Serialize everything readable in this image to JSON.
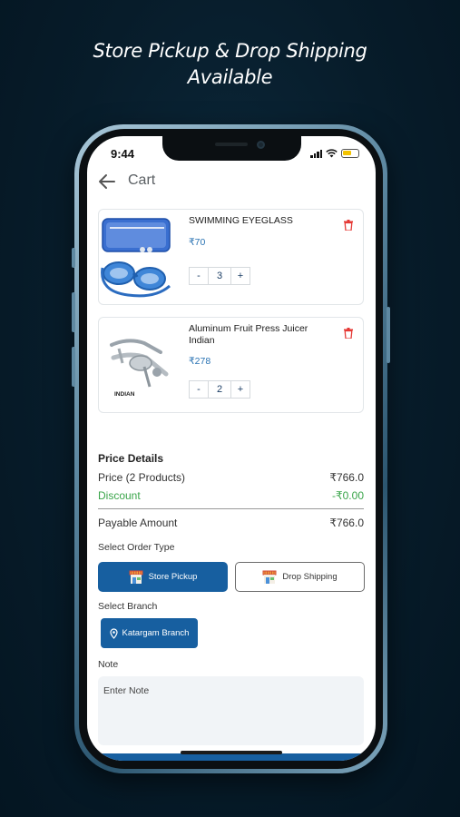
{
  "promo": {
    "line1": "Store Pickup & Drop Shipping",
    "line2": "Available"
  },
  "status_bar": {
    "time": "9:44",
    "icons": [
      "signal-icon",
      "wifi-icon",
      "battery-icon"
    ],
    "battery_color": "#f3c300"
  },
  "header": {
    "title": "Cart",
    "back_icon": "arrow-left-icon"
  },
  "cart_items": [
    {
      "name": "SWIMMING EYEGLASS",
      "price": "₹70",
      "quantity": "3",
      "decrement": "-",
      "increment": "+"
    },
    {
      "name": "Aluminum Fruit Press Juicer Indian",
      "price": "₹278",
      "quantity": "2",
      "decrement": "-",
      "increment": "+",
      "image_label": "INDIAN"
    }
  ],
  "price_details": {
    "title": "Price Details",
    "price_label": "Price (2 Products)",
    "price_value": "₹766.0",
    "discount_label": "Discount",
    "discount_value": "-₹0.00",
    "payable_label": "Payable Amount",
    "payable_value": "₹766.0"
  },
  "order_type": {
    "label": "Select Order Type",
    "options": [
      "Store Pickup",
      "Drop Shipping"
    ],
    "selected": "Store Pickup"
  },
  "branch": {
    "label": "Select Branch",
    "selected": "Katargam Branch"
  },
  "note": {
    "label": "Note",
    "placeholder": "Enter Note"
  },
  "colors": {
    "primary": "#175fa0",
    "price": "#2a73b3",
    "discount": "#3aa54a",
    "delete": "#e53935",
    "background": "#071c2a"
  }
}
